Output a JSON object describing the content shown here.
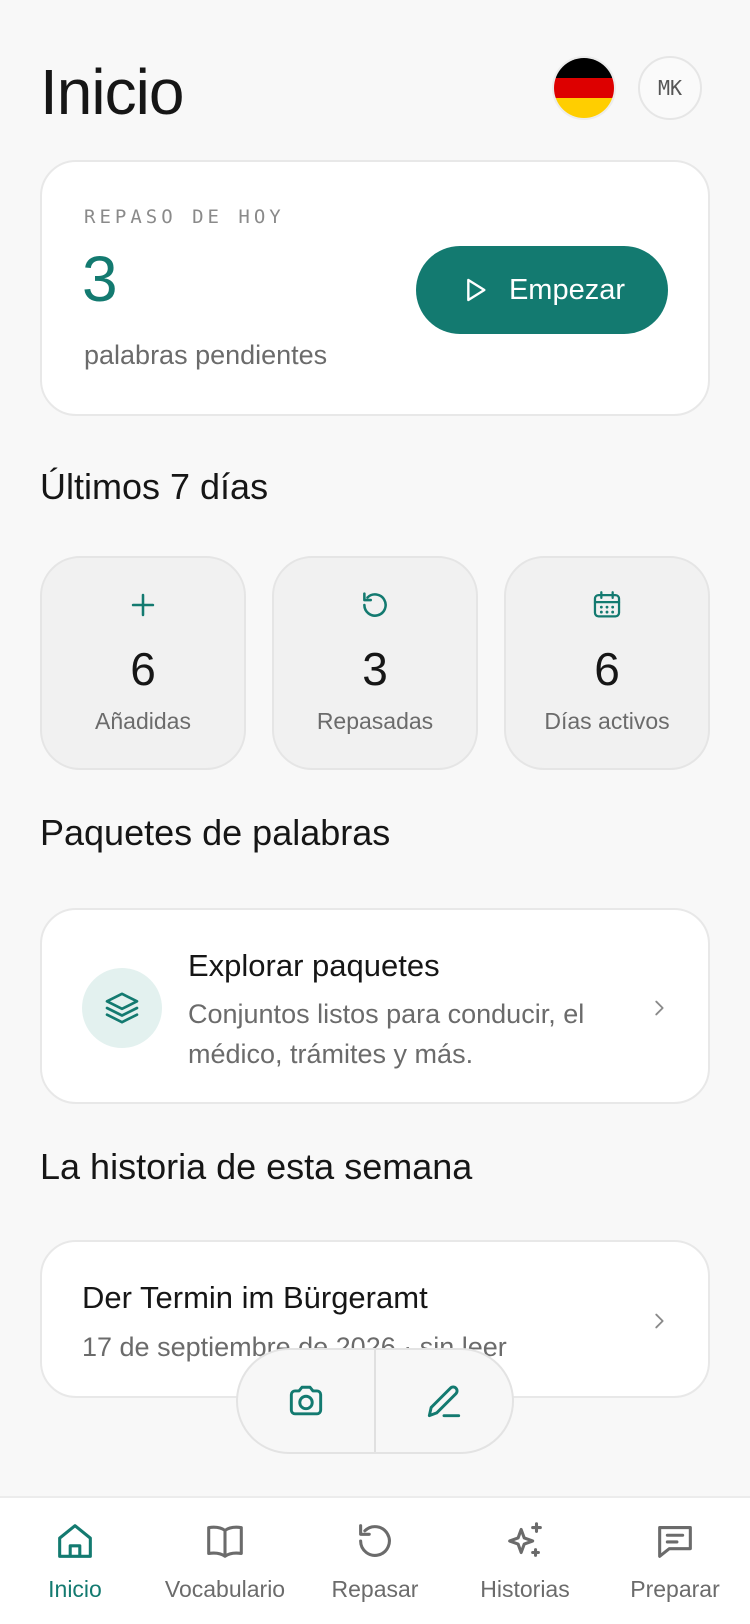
{
  "header": {
    "title": "Inicio",
    "language_flag": "germany-flag",
    "avatar_initials": "MK"
  },
  "review": {
    "eyebrow": "REPASO DE HOY",
    "count": "3",
    "subtitle": "palabras pendientes",
    "start_label": "Empezar"
  },
  "stats": {
    "title": "Últimos 7 días",
    "items": [
      {
        "icon": "plus-icon",
        "value": "6",
        "label": "Añadidas"
      },
      {
        "icon": "rotate-icon",
        "value": "3",
        "label": "Repasadas"
      },
      {
        "icon": "calendar-icon",
        "value": "6",
        "label": "Días activos"
      }
    ]
  },
  "packs": {
    "section_title": "Paquetes de palabras",
    "title": "Explorar paquetes",
    "description": "Conjuntos listos para conducir, el médico, trámites y más."
  },
  "story": {
    "section_title": "La historia de esta semana",
    "title": "Der Termin im Bürgeramt",
    "meta": "17 de septiembre de 2026 · sin leer"
  },
  "fab": {
    "left_icon": "camera-icon",
    "right_icon": "pencil-icon"
  },
  "nav": {
    "items": [
      {
        "icon": "home-icon",
        "label": "Inicio",
        "active": true
      },
      {
        "icon": "book-icon",
        "label": "Vocabulario",
        "active": false
      },
      {
        "icon": "rotate-icon",
        "label": "Repasar",
        "active": false
      },
      {
        "icon": "sparkles-icon",
        "label": "Historias",
        "active": false
      },
      {
        "icon": "message-icon",
        "label": "Preparar",
        "active": false
      }
    ]
  },
  "colors": {
    "accent": "#137a70",
    "accent_light": "#e3f1ef",
    "background": "#f8f8f8",
    "flag_black": "#000000",
    "flag_red": "#dd0000",
    "flag_gold": "#ffce00"
  }
}
